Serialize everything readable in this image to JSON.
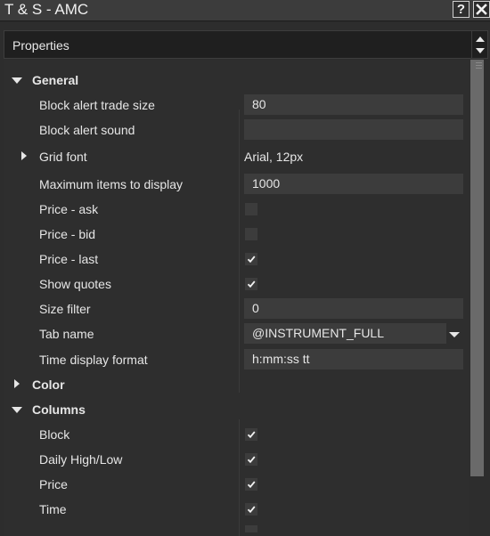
{
  "window": {
    "title": "T & S - AMC",
    "help_label": "?"
  },
  "properties_header": "Properties",
  "categories": {
    "general": "General",
    "color": "Color",
    "columns": "Columns"
  },
  "general": {
    "block_alert_trade_size": {
      "label": "Block alert trade size",
      "value": "80"
    },
    "block_alert_sound": {
      "label": "Block alert sound",
      "value": ""
    },
    "grid_font": {
      "label": "Grid font",
      "value": "Arial, 12px"
    },
    "max_items": {
      "label": "Maximum items to display",
      "value": "1000"
    },
    "price_ask": {
      "label": "Price - ask",
      "checked": false
    },
    "price_bid": {
      "label": "Price - bid",
      "checked": false
    },
    "price_last": {
      "label": "Price - last",
      "checked": true
    },
    "show_quotes": {
      "label": "Show quotes",
      "checked": true
    },
    "size_filter": {
      "label": "Size filter",
      "value": "0"
    },
    "tab_name": {
      "label": "Tab name",
      "value": "@INSTRUMENT_FULL"
    },
    "time_display_format": {
      "label": "Time display format",
      "value": "h:mm:ss tt"
    }
  },
  "columns": {
    "block": {
      "label": "Block",
      "checked": true
    },
    "daily_high_low": {
      "label": "Daily High/Low",
      "checked": true
    },
    "price": {
      "label": "Price",
      "checked": true
    },
    "time": {
      "label": "Time",
      "checked": true
    }
  },
  "icons": {
    "help": "question-mark-icon",
    "close": "close-x-icon",
    "expanded": "triangle-down-icon",
    "collapsed": "triangle-right-icon",
    "check": "checkmark-icon",
    "dropdown": "chevron-down-icon"
  },
  "colors": {
    "background": "#2d2d2d",
    "field": "#3c3c3c",
    "text": "#e6e6e6"
  }
}
